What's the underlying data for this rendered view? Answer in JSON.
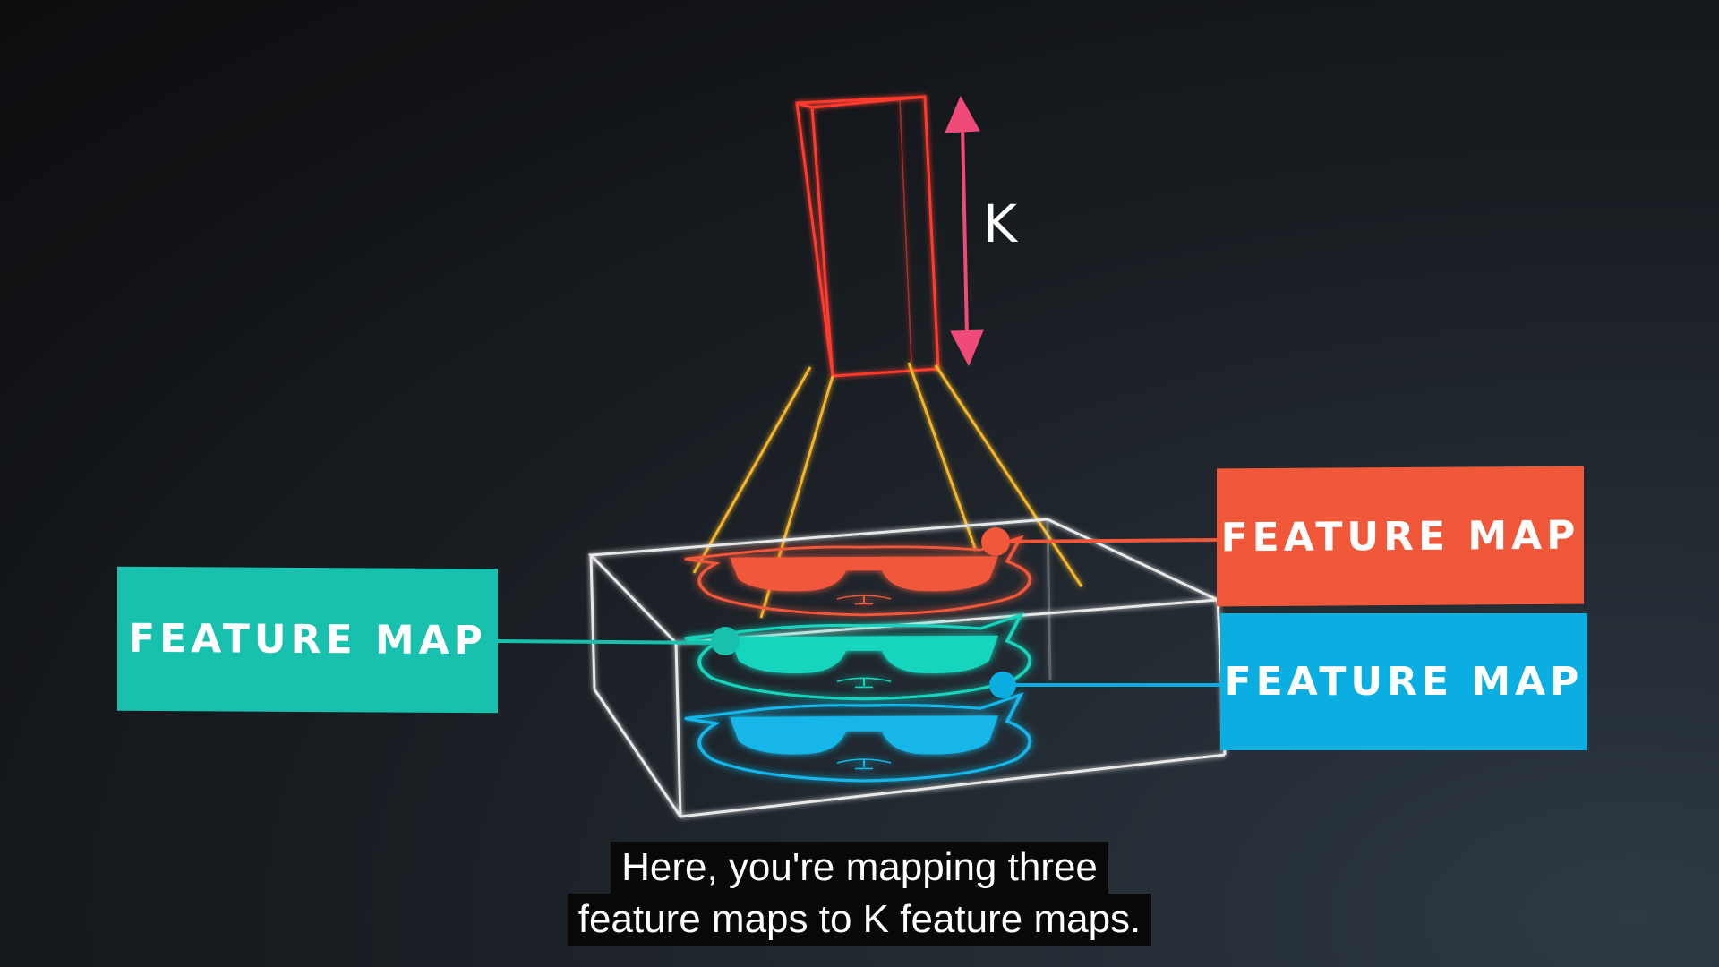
{
  "k_label": "K",
  "feature_map_left": "FEATURE MAP",
  "feature_map_top_right": "FEATURE MAP",
  "feature_map_bottom_right": "FEATURE MAP",
  "subtitle_line_1": "Here, you're mapping three",
  "subtitle_line_2": "feature maps to K feature maps.",
  "colors": {
    "teal": "#18c1ae",
    "orange": "#f1583a",
    "blue": "#0aaee0",
    "output_column": "#ff3b2f",
    "arrow": "#f04a78",
    "projection_lines": "#f5b52a"
  }
}
